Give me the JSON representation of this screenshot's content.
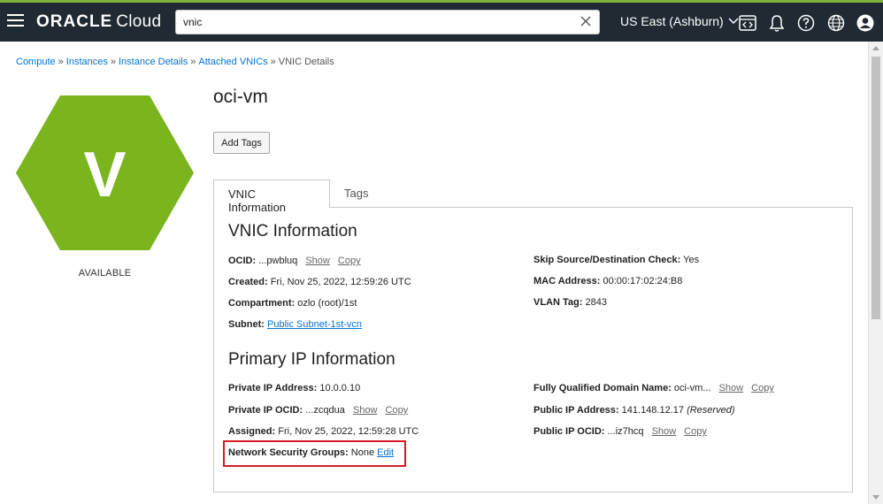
{
  "topbar": {
    "logo_brand": "ORACLE",
    "logo_product": "Cloud",
    "search_value": "vnic",
    "region": "US East (Ashburn)"
  },
  "breadcrumb": [
    {
      "label": "Compute"
    },
    {
      "label": "Instances"
    },
    {
      "label": "Instance Details"
    },
    {
      "label": "Attached VNICs"
    },
    {
      "label": "VNIC Details"
    }
  ],
  "badge": {
    "letter": "V",
    "status": "AVAILABLE",
    "color": "#7ab51d"
  },
  "page": {
    "title": "oci-vm",
    "add_tags": "Add Tags"
  },
  "tabs": {
    "active": "VNIC Information",
    "inactive": "Tags"
  },
  "vnic_info": {
    "heading": "VNIC Information",
    "ocid_label": "OCID:",
    "ocid_value": "...pwbluq",
    "show": "Show",
    "copy": "Copy",
    "created_label": "Created:",
    "created_value": "Fri, Nov 25, 2022, 12:59:26 UTC",
    "compartment_label": "Compartment:",
    "compartment_value": "ozlo (root)/1st",
    "subnet_label": "Subnet:",
    "subnet_value": "Public Subnet-1st-vcn",
    "skip_label": "Skip Source/Destination Check:",
    "skip_value": "Yes",
    "mac_label": "MAC Address:",
    "mac_value": "00:00:17:02:24:B8",
    "vlan_label": "VLAN Tag:",
    "vlan_value": "2843"
  },
  "primary_ip": {
    "heading": "Primary IP Information",
    "private_ip_label": "Private IP Address:",
    "private_ip_value": "10.0.0.10",
    "private_ocid_label": "Private IP OCID:",
    "private_ocid_value": "...zcqdua",
    "assigned_label": "Assigned:",
    "assigned_value": "Fri, Nov 25, 2022, 12:59:28 UTC",
    "nsg_label": "Network Security Groups:",
    "nsg_value": "None",
    "nsg_edit": "Edit",
    "fqdn_label": "Fully Qualified Domain Name:",
    "fqdn_value": "oci-vm...",
    "public_ip_label": "Public IP Address:",
    "public_ip_value": "141.148.12.17",
    "public_ip_note": "(Reserved)",
    "public_ocid_label": "Public IP OCID:",
    "public_ocid_value": "...iz7hcq",
    "show": "Show",
    "copy": "Copy"
  }
}
